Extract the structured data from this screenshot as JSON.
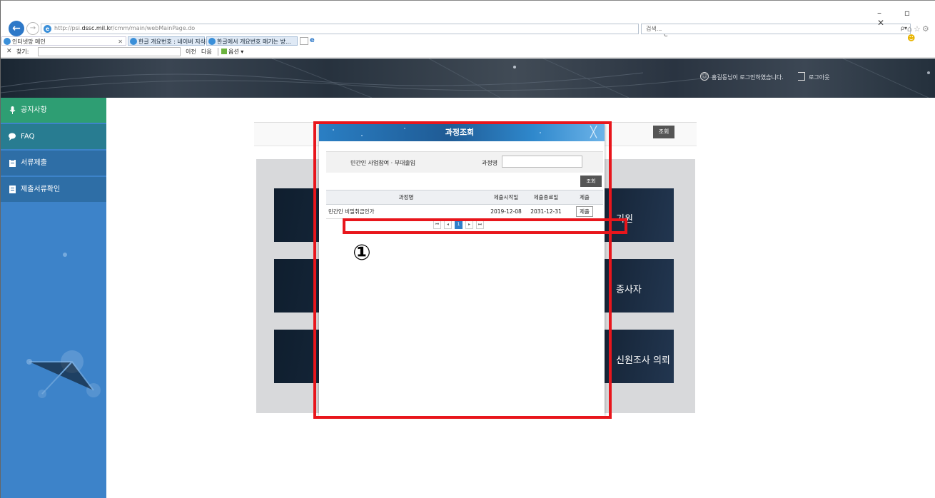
{
  "browser": {
    "address_domain_prefix": "http://psi.",
    "address_domain": "dssc.mil.kr",
    "address_path": "/cmm/main/webMainPage.do",
    "address_controls": "▾ C",
    "search_placeholder": "검색...",
    "search_controls": "ρ▾",
    "window_controls": "– ▫ ✕",
    "toolbar_icons": "⌂☆⚙",
    "toolbar_smile": "☻",
    "tabs": [
      {
        "label": "인터넷망 메인",
        "close": "✕"
      },
      {
        "label": "한글 개요번호 : 네이버 지식iN..."
      },
      {
        "label": "한글에서 개요번호 매기는 방..."
      }
    ],
    "ie_logo": "e",
    "find": {
      "close": "✕",
      "label": "찾기:",
      "prev": "이전",
      "next": "다음",
      "options": "옵션 ▾"
    }
  },
  "header": {
    "user_message": "홍길동님이 로그인하였습니다.",
    "logout": "로그아웃"
  },
  "sidebar": {
    "items": [
      {
        "label": "공지사항"
      },
      {
        "label": "FAQ"
      },
      {
        "label": "서류제출"
      },
      {
        "label": "제출서류확인"
      }
    ]
  },
  "main": {
    "search_button": "조회",
    "cards": [
      {
        "label": "기원"
      },
      {
        "label": "종사자"
      },
      {
        "label": "신원조사 의뢰"
      }
    ]
  },
  "modal": {
    "title": "과정조회",
    "close": "╳",
    "filter_label": "민간인 사업참여 · 부대출입",
    "course_label": "과정명",
    "course_value": "",
    "search_button": "조회",
    "table": {
      "columns": [
        "과정명",
        "제출시작일",
        "제출종료일",
        "제출"
      ],
      "rows": [
        {
          "name": "민간인 비밀취급인가",
          "start": "2019-12-08",
          "end": "2031-12-31",
          "action": "제출"
        }
      ]
    },
    "pagination": {
      "first": "⏮",
      "prev": "◂",
      "current": "1",
      "next": "▸",
      "last": "⏭"
    }
  },
  "annotation": {
    "marker": "①",
    "highlight_color": "#e8161c"
  },
  "colors": {
    "sidebar": "#3d83c9",
    "notice_item": "#2e9e73",
    "faq_item": "#287c91",
    "modal_header": "#1f5b95",
    "pager_active": "#2f7fca"
  }
}
